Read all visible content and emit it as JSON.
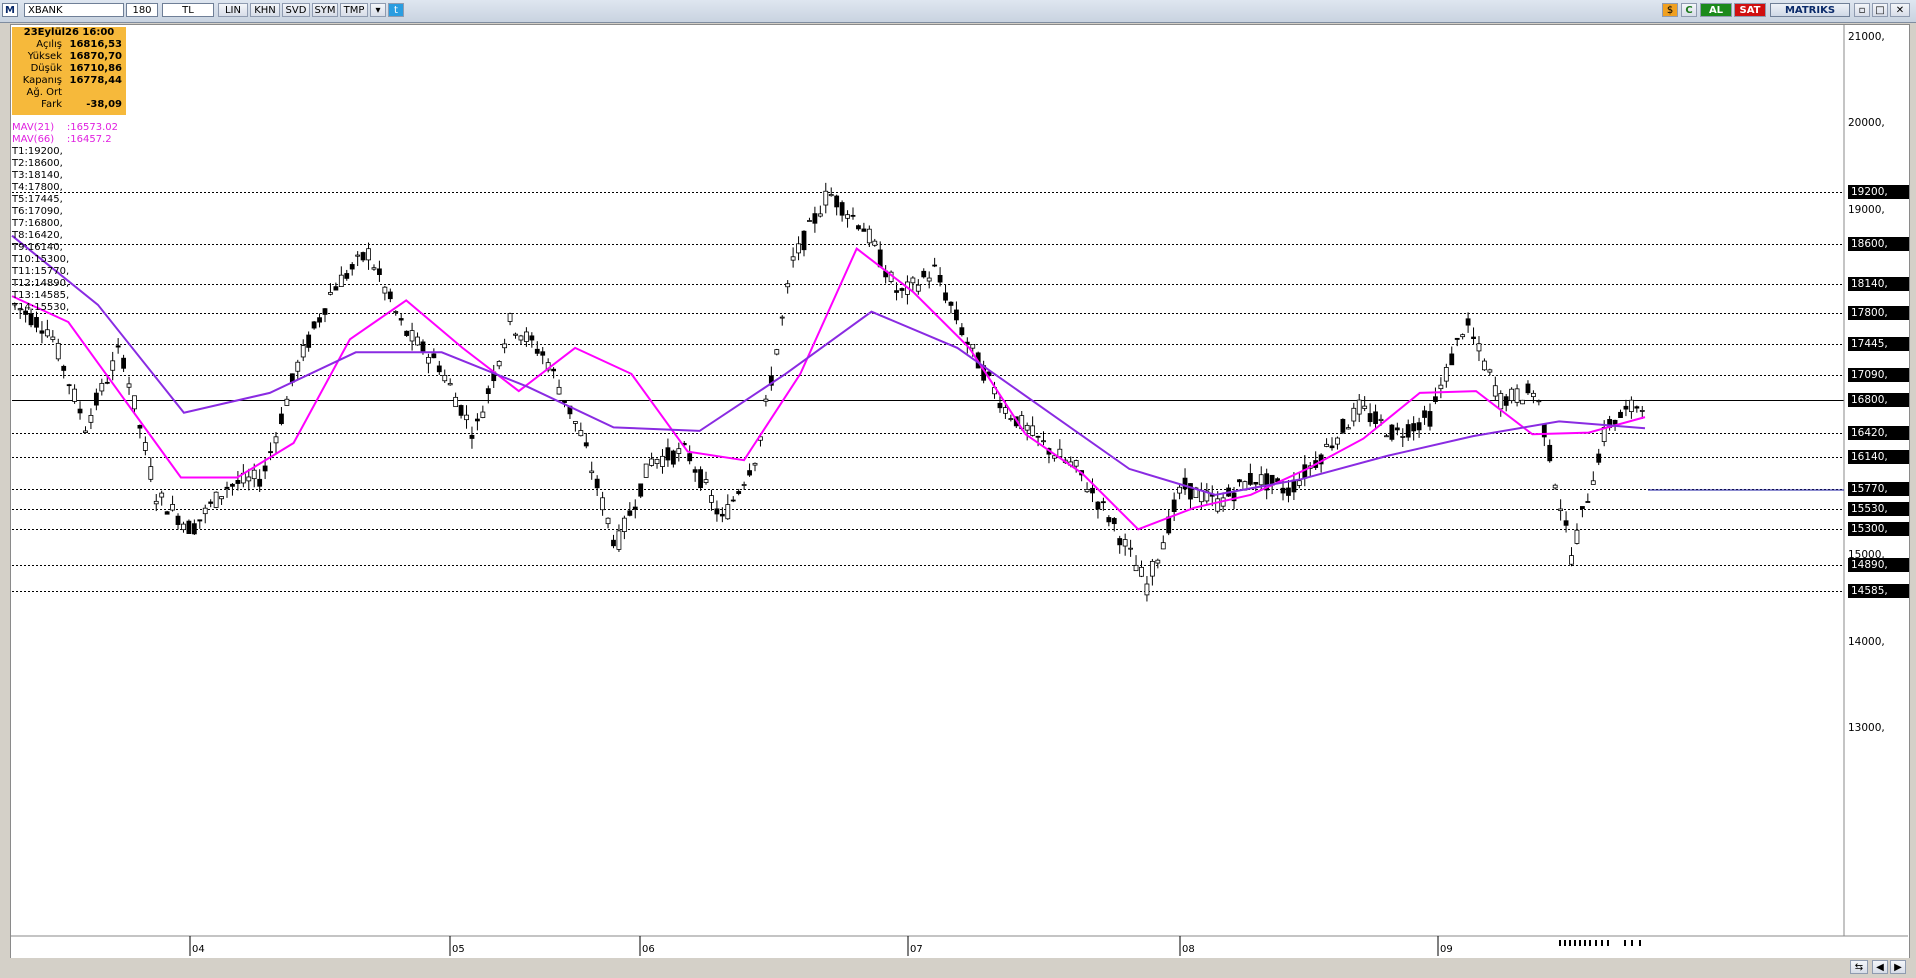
{
  "toolbar": {
    "logo": "M",
    "symbol": "XBANK",
    "period": "180",
    "currency": "TL",
    "scale": "LIN",
    "khn": "KHN",
    "svd": "SVD",
    "sym": "SYM",
    "tmp": "TMP",
    "buy_label": "AL",
    "sell_label": "SAT",
    "brand": "MATRIKS",
    "colors": {
      "buy": "#1c8a1c",
      "sell": "#d01010",
      "brand_text": "#0a2a6a"
    }
  },
  "ohlc": {
    "datetime": "23Eylül26 16:00",
    "rows": [
      {
        "label": "Açılış",
        "value": "16816,53"
      },
      {
        "label": "Yüksek",
        "value": "16870,70"
      },
      {
        "label": "Düşük",
        "value": "16710,86"
      },
      {
        "label": "Kapanış",
        "value": "16778,44"
      },
      {
        "label": "Ağ. Ort",
        "value": ""
      },
      {
        "label": "Fark",
        "value": "-38,09"
      }
    ]
  },
  "indicators": [
    {
      "label": "MAV(21)",
      "value": ":16573.02",
      "color": "#ff00ff"
    },
    {
      "label": "MAV(66)",
      "value": ":16457.2",
      "color": "#8a2be2"
    }
  ],
  "levels": [
    "T1:19200,",
    "T2:18600,",
    "T3:18140,",
    "T4:17800,",
    "T5:17445,",
    "T6:17090,",
    "T7:16800,",
    "T8:16420,",
    "T9:16140,",
    "T10:15300,",
    "T11:15770,",
    "T12:14890,",
    "T13:14585,",
    "T14:15530,"
  ],
  "chart_data": {
    "type": "candlestick",
    "ylim": [
      12600,
      21200
    ],
    "y_ticks": [
      {
        "value": 21000,
        "label": "21000,"
      },
      {
        "value": 20000,
        "label": "20000,"
      },
      {
        "value": 19000,
        "label": "19000,"
      },
      {
        "value": 15000,
        "label": "15000,"
      },
      {
        "value": 14000,
        "label": "14000,"
      },
      {
        "value": 13000,
        "label": "13000,"
      }
    ],
    "level_values": [
      19200,
      18600,
      18140,
      17800,
      17445,
      17090,
      16800,
      16420,
      16140,
      15770,
      15530,
      15300,
      14890,
      14585
    ],
    "level_labels": [
      "19200,",
      "18600,",
      "18140,",
      "17800,",
      "17445,",
      "17090,",
      "16800,",
      "16420,",
      "16140,",
      "15770,",
      "15530,",
      "15300,",
      "14890,",
      "14585,"
    ],
    "x_labels": [
      "04",
      "05",
      "06",
      "07",
      "08",
      "09"
    ],
    "price_waypoints": [
      17900,
      17600,
      16500,
      17400,
      15700,
      15300,
      15800,
      15900,
      17200,
      18100,
      18500,
      17600,
      17200,
      16400,
      17700,
      17300,
      16400,
      15100,
      16100,
      16200,
      15400,
      16200,
      18400,
      19200,
      18800,
      18000,
      18300,
      17400,
      16700,
      16300,
      16000,
      15400,
      14650,
      15800,
      15600,
      15900,
      15750,
      16200,
      16700,
      16400,
      16600,
      17700,
      16800,
      16900,
      15000,
      16500,
      16780
    ],
    "mav21": [
      18000,
      17700,
      16800,
      15900,
      15900,
      16300,
      17500,
      17950,
      17400,
      16900,
      17400,
      17100,
      16200,
      16100,
      17100,
      18550,
      18050,
      17400,
      16400,
      15950,
      15300,
      15550,
      15700,
      16000,
      16350,
      16880,
      16900,
      16400,
      16420,
      16600
    ],
    "mav66": [
      18700,
      17900,
      16650,
      16880,
      17350,
      17350,
      16950,
      16480,
      16440,
      17100,
      17820,
      17400,
      16700,
      16000,
      15700,
      15880,
      16150,
      16380,
      16550,
      16470
    ]
  }
}
